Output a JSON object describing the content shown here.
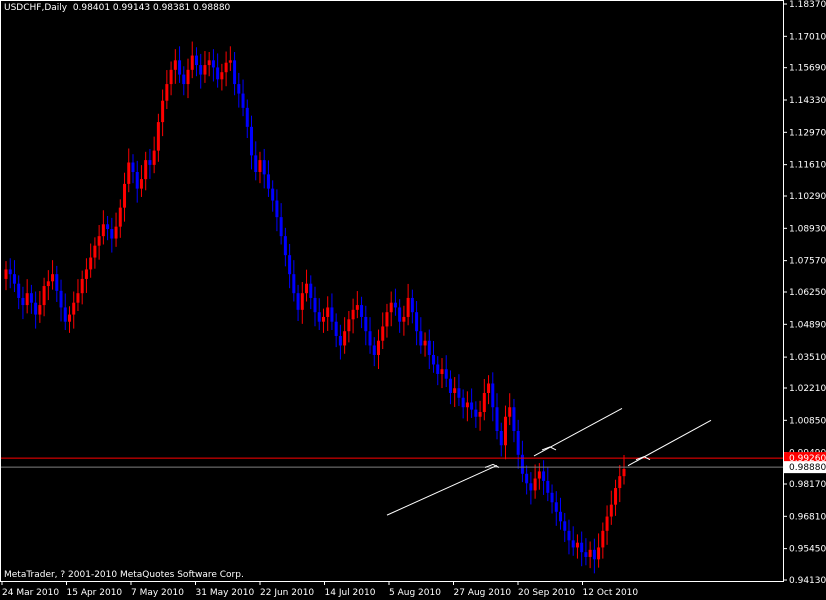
{
  "header": {
    "symbol": "USDCHF,Daily",
    "ohlc": "0.98401 0.99143 0.98381 0.98880"
  },
  "copyright": "MetaTrader, ? 2001-2010 MetaQuotes Software Corp.",
  "colors": {
    "background": "#000000",
    "frame": "#ffffff",
    "bull": "#ff0000",
    "bear": "#0000ff",
    "bid_line": "#808080",
    "red_line": "#ff0000",
    "trendline": "#ffffff"
  },
  "chart_data": {
    "type": "candlestick",
    "symbol": "USDCHF",
    "timeframe": "Daily",
    "y_ticks": [
      "1.18370",
      "1.17010",
      "1.15690",
      "1.14330",
      "1.12970",
      "1.11610",
      "1.10290",
      "1.08930",
      "1.07570",
      "1.06250",
      "1.04890",
      "1.03510",
      "1.02210",
      "1.00850",
      "0.99490",
      "0.98170",
      "0.96810",
      "0.95450",
      "0.94130"
    ],
    "x_ticks": [
      "24 Mar 2010",
      "15 Apr 2010",
      "7 May 2010",
      "31 May 2010",
      "22 Jun 2010",
      "14 Jul 2010",
      "5 Aug 2010",
      "27 Aug 2010",
      "20 Sep 2010",
      "12 Oct 2010"
    ],
    "ylim": [
      0.9413,
      1.1837
    ],
    "current_price": 0.9888,
    "current_price_label": "0.98880",
    "red_level": 0.9926,
    "red_level_label": "0.99260",
    "closes": [
      1.072,
      1.07,
      1.066,
      1.06,
      1.057,
      1.062,
      1.058,
      1.053,
      1.057,
      1.065,
      1.067,
      1.07,
      1.063,
      1.056,
      1.05,
      1.053,
      1.058,
      1.062,
      1.068,
      1.072,
      1.077,
      1.082,
      1.086,
      1.091,
      1.089,
      1.085,
      1.09,
      1.098,
      1.108,
      1.117,
      1.113,
      1.106,
      1.11,
      1.118,
      1.116,
      1.122,
      1.134,
      1.143,
      1.15,
      1.156,
      1.16,
      1.154,
      1.15,
      1.156,
      1.162,
      1.158,
      1.154,
      1.158,
      1.16,
      1.157,
      1.152,
      1.155,
      1.159,
      1.16,
      1.15,
      1.146,
      1.14,
      1.132,
      1.12,
      1.113,
      1.118,
      1.112,
      1.106,
      1.101,
      1.094,
      1.086,
      1.078,
      1.07,
      1.062,
      1.055,
      1.062,
      1.066,
      1.06,
      1.054,
      1.05,
      1.052,
      1.056,
      1.05,
      1.044,
      1.04,
      1.046,
      1.051,
      1.055,
      1.057,
      1.052,
      1.046,
      1.04,
      1.036,
      1.042,
      1.048,
      1.054,
      1.058,
      1.056,
      1.05,
      1.052,
      1.06,
      1.054,
      1.046,
      1.04,
      1.042,
      1.036,
      1.032,
      1.028,
      1.03,
      1.026,
      1.02,
      1.022,
      1.018,
      1.014,
      1.016,
      1.013,
      1.01,
      1.012,
      1.02,
      1.024,
      1.014,
      1.004,
      0.998,
      1.01,
      1.014,
      1.004,
      0.994,
      0.986,
      0.982,
      0.979,
      0.984,
      0.987,
      0.983,
      0.978,
      0.974,
      0.97,
      0.966,
      0.962,
      0.958,
      0.955,
      0.957,
      0.953,
      0.951,
      0.954,
      0.95,
      0.955,
      0.962,
      0.968,
      0.973,
      0.98,
      0.985,
      0.988
    ],
    "trendlines": [
      {
        "from": [
          "27 Aug 2010",
          0.9686
        ],
        "to": [
          "20 Sep 2010",
          0.9895
        ]
      },
      {
        "from": [
          "20 Sep 2010",
          0.9935
        ],
        "to": [
          "12 Oct 2010",
          1.0135
        ]
      },
      {
        "from": [
          "12 Oct 2010",
          0.9894
        ],
        "to": [
          "12 Oct 2010",
          1.0085
        ]
      }
    ]
  }
}
